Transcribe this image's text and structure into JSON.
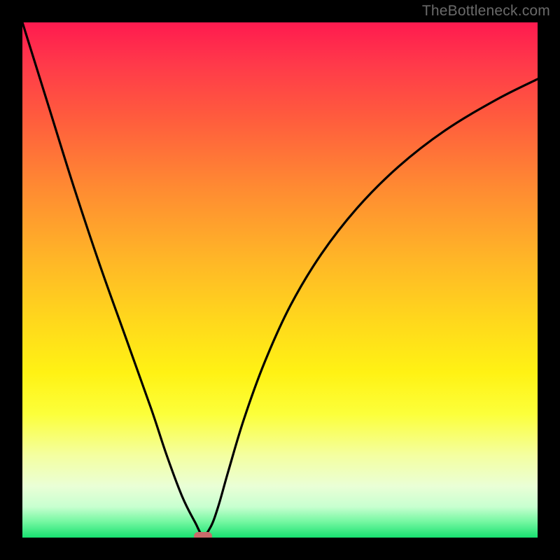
{
  "watermark": "TheBottleneck.com",
  "chart_data": {
    "type": "line",
    "title": "",
    "xlabel": "",
    "ylabel": "",
    "xlim": [
      0,
      100
    ],
    "ylim": [
      0,
      100
    ],
    "grid": false,
    "background": "rainbow-gradient-vertical",
    "series": [
      {
        "name": "bottleneck-curve",
        "color": "#000000",
        "x": [
          0,
          5,
          10,
          15,
          20,
          25,
          28,
          31,
          33.5,
          35,
          36.5,
          38,
          40,
          43,
          47,
          52,
          58,
          65,
          73,
          82,
          92,
          100
        ],
        "values": [
          100,
          84,
          68,
          53,
          39,
          25,
          16,
          8,
          3,
          0.5,
          2,
          6,
          13,
          23,
          34,
          45,
          55,
          64,
          72,
          79,
          85,
          89
        ]
      }
    ],
    "marker": {
      "x": 35,
      "y": 0.3,
      "color": "#c96b6b"
    },
    "frame": {
      "border_px": 32,
      "border_color": "#000000"
    }
  }
}
